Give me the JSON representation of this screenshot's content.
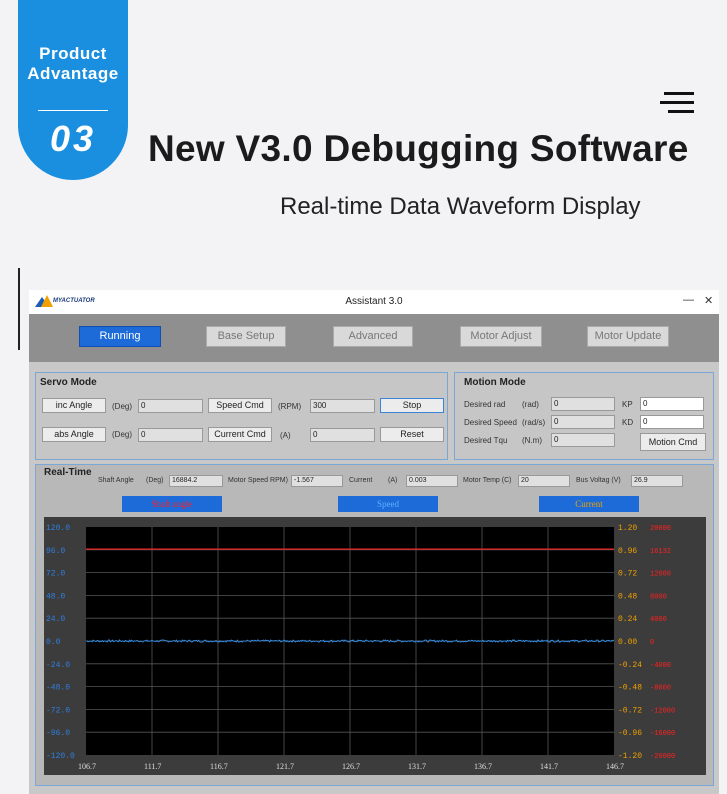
{
  "badge": {
    "line1": "Product",
    "line2": "Advantage",
    "number": "03"
  },
  "headline": "New V3.0 Debugging Software",
  "subline": "Real-time Data Waveform Display",
  "window": {
    "title": "Assistant 3.0",
    "logo_text": "MYACTUATOR",
    "minimize": "—",
    "close": "✕"
  },
  "nav": [
    "Running",
    "Base Setup",
    "Advanced",
    "Motor Adjust",
    "Motor Update"
  ],
  "servo": {
    "title": "Servo Mode",
    "inc_angle": "inc Angle",
    "abs_angle": "abs Angle",
    "deg_unit": "(Deg)",
    "inc_value": "0",
    "abs_value": "0",
    "speed_cmd": "Speed Cmd",
    "rpm_unit": "(RPM)",
    "speed_value": "300",
    "current_cmd": "Current Cmd",
    "a_unit": "(A)",
    "current_value": "0",
    "stop": "Stop",
    "reset": "Reset"
  },
  "motion": {
    "title": "Motion Mode",
    "desired_rad": "Desired rad",
    "rad_unit": "(rad)",
    "rad_value": "0",
    "desired_speed": "Desired Speed",
    "speed_unit": "(rad/s)",
    "speed_value": "0",
    "desired_tqu": "Desired Tqu",
    "tqu_unit": "(N.m)",
    "tqu_value": "0",
    "kp": "KP",
    "kp_value": "0",
    "kd": "KD",
    "kd_value": "0",
    "cmd": "Motion Cmd"
  },
  "realtime": {
    "title": "Real-Time",
    "shaft_angle": "Shaft Angle",
    "shaft_unit": "(Deg)",
    "shaft_value": "16884.2",
    "motor_speed": "Motor Speed RPM)",
    "motor_speed_value": "-1.567",
    "current": "Current",
    "current_unit": "(A)",
    "current_value": "0.003",
    "motor_temp": "Motor Temp (C)",
    "temp_value": "20",
    "bus_voltage": "Bus Voltag (V)",
    "voltage_value": "26.9",
    "legend": [
      "Shaft angle",
      "Speed",
      "Current"
    ]
  },
  "colors": {
    "accent": "#1a8fe0",
    "nav_active": "#1c6bd8",
    "shaft": "#ff2020",
    "speed": "#3399ff",
    "current": "#f0a000"
  },
  "chart_data": {
    "type": "line",
    "x_ticks": [
      "106.7",
      "111.7",
      "116.7",
      "121.7",
      "126.7",
      "131.7",
      "136.7",
      "141.7",
      "146.7"
    ],
    "y_left_ticks": [
      "120.0",
      "96.0",
      "72.0",
      "48.0",
      "24.0",
      "0.0",
      "-24.0",
      "-48.0",
      "-72.0",
      "-96.0",
      "-120.0"
    ],
    "y_right_ticks": [
      "1.20",
      "0.96",
      "0.72",
      "0.48",
      "0.24",
      "0.00",
      "-0.24",
      "-0.48",
      "-0.72",
      "-0.96",
      "-1.20"
    ],
    "y_right2_ticks": [
      "20000",
      "16132",
      "12000",
      "8000",
      "4000",
      "0",
      "-4000",
      "-8000",
      "-12000",
      "-16000",
      "-20000"
    ],
    "xlim": [
      106.7,
      146.7
    ],
    "ylim": [
      -120,
      120
    ],
    "grid": true,
    "series": [
      {
        "name": "Shaft angle",
        "color": "#ff2020",
        "axis": "right2",
        "x": [
          106.7,
          146.7
        ],
        "values": [
          16132,
          16132
        ]
      },
      {
        "name": "Speed",
        "color": "#3399ff",
        "axis": "left",
        "x": [
          106.7,
          146.7
        ],
        "values": [
          0,
          0
        ],
        "noise": 0.4
      }
    ]
  }
}
